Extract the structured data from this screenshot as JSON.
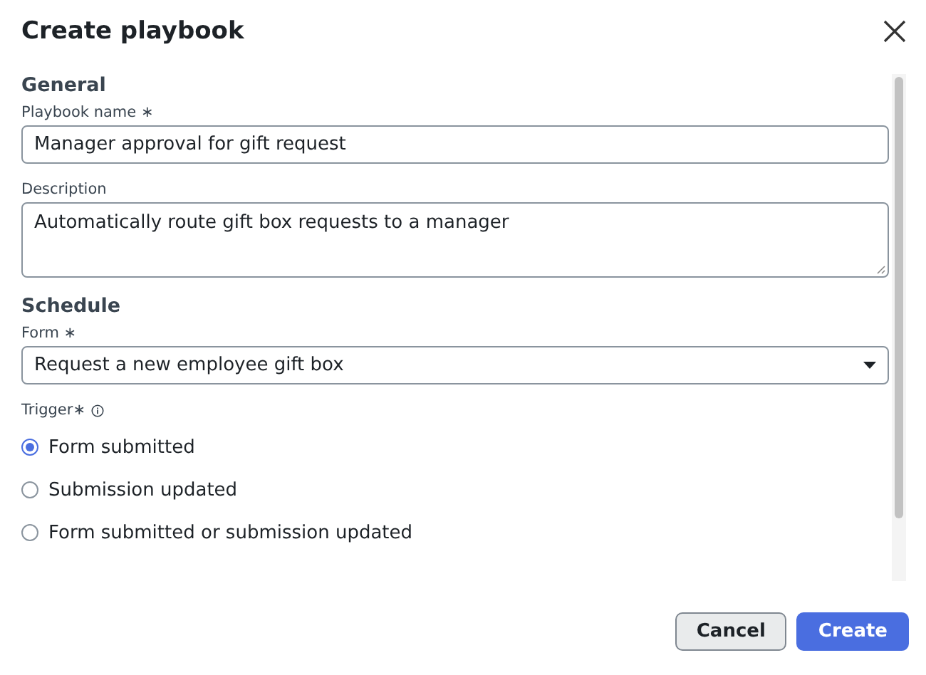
{
  "dialog": {
    "title": "Create playbook"
  },
  "sections": [
    {
      "heading": "General",
      "fields": [
        {
          "kind": "text",
          "label": "Playbook name ∗",
          "value": "Manager approval for gift request"
        },
        {
          "kind": "textarea",
          "label": "Description",
          "value": "Automatically route gift box requests to a manager"
        }
      ]
    },
    {
      "heading": "Schedule",
      "fields": [
        {
          "kind": "select",
          "label": "Form ∗",
          "value": "Request a new employee gift box"
        },
        {
          "kind": "radio",
          "label": "Trigger∗",
          "info": true,
          "options": [
            {
              "label": "Form submitted",
              "selected": true
            },
            {
              "label": "Submission updated",
              "selected": false
            },
            {
              "label": "Form submitted or submission updated",
              "selected": false
            }
          ]
        }
      ]
    }
  ],
  "buttons": [
    {
      "label": "Cancel",
      "kind": "secondary"
    },
    {
      "label": "Create",
      "kind": "primary"
    }
  ]
}
